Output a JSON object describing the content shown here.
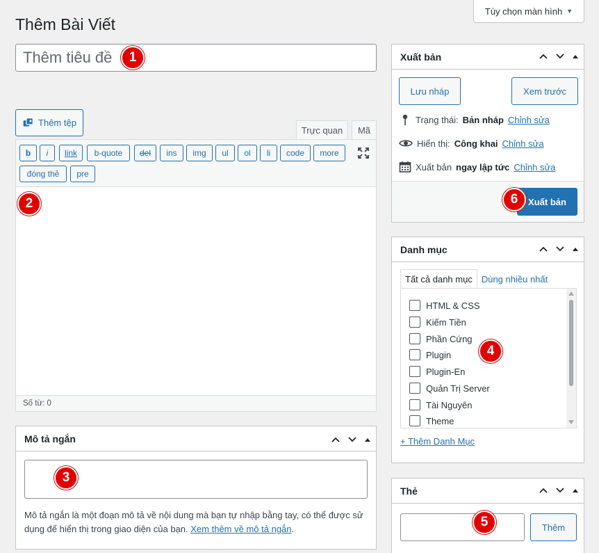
{
  "screen_options": {
    "label": "Tùy chọn màn hình"
  },
  "page": {
    "title": "Thêm Bài Viết"
  },
  "title_field": {
    "placeholder": "Thêm tiêu đề"
  },
  "badges": {
    "b1": "1",
    "b2": "2",
    "b3": "3",
    "b4": "4",
    "b5": "5",
    "b6": "6"
  },
  "editor": {
    "add_media_label": "Thêm tệp",
    "tab_visual": "Trực quan",
    "tab_code": "Mã",
    "toolbar": {
      "b": "b",
      "i": "i",
      "link": "link",
      "bquote": "b-quote",
      "del": "del",
      "ins": "ins",
      "img": "img",
      "ul": "ul",
      "ol": "ol",
      "li": "li",
      "code": "code",
      "more": "more",
      "close_tags": "đóng thẻ",
      "pre": "pre"
    },
    "word_count": "Số từ: 0"
  },
  "excerpt": {
    "title": "Mô tả ngắn",
    "help_text": "Mô tả ngắn là một đoạn mô tả về nội dung mà bạn tự nhập bằng tay, có thể được sử dụng để hiển thị trong giao diện của bạn.",
    "help_link": "Xem thêm về mô tả ngắn",
    "help_end": "."
  },
  "publish": {
    "title": "Xuất bản",
    "save_draft": "Lưu nháp",
    "preview": "Xem trước",
    "status_label": "Trạng thái:",
    "status_value": "Bản nháp",
    "visibility_label": "Hiển thị:",
    "visibility_value": "Công khai",
    "schedule_label": "Xuất bản",
    "schedule_value": "ngay lập tức",
    "edit_link": "Chỉnh sửa",
    "publish_button": "Xuất bản"
  },
  "categories": {
    "title": "Danh mục",
    "tab_all": "Tất cả danh mục",
    "tab_popular": "Dùng nhiều nhất",
    "items": [
      "HTML & CSS",
      "Kiếm Tiền",
      "Phần Cứng",
      "Plugin",
      "Plugin-En",
      "Quản Trị Server",
      "Tài Nguyên",
      "Theme"
    ],
    "add_link": "+ Thêm Danh Mục"
  },
  "tags": {
    "title": "Thẻ",
    "add_button": "Thêm"
  },
  "colors": {
    "accent": "#2271b1",
    "badge": "#e20000"
  }
}
